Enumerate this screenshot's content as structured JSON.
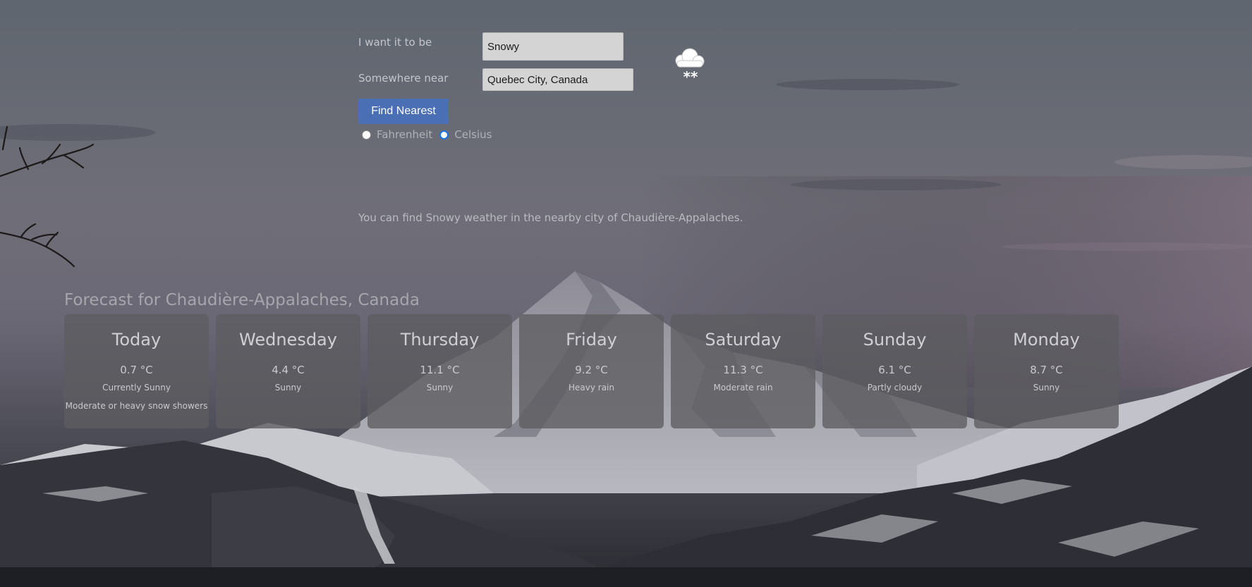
{
  "form": {
    "condition_label": "I want it to be",
    "condition_value": "Snowy",
    "location_label": "Somewhere near",
    "location_value": "Quebec City, Canada",
    "find_button": "Find Nearest",
    "units": {
      "fahrenheit_label": "Fahrenheit",
      "celsius_label": "Celsius",
      "selected": "Celsius"
    },
    "condition_icon": "snow-cloud-icon"
  },
  "result": {
    "message": "You can find Snowy weather in the nearby city of Chaudière-Appalaches."
  },
  "forecast": {
    "title": "Forecast for Chaudière-Appalaches, Canada",
    "days": [
      {
        "day": "Today",
        "temp": "0.7 °C",
        "condition": "Currently Sunny",
        "detail": "Moderate or heavy snow showers"
      },
      {
        "day": "Wednesday",
        "temp": "4.4 °C",
        "condition": "Sunny"
      },
      {
        "day": "Thursday",
        "temp": "11.1 °C",
        "condition": "Sunny"
      },
      {
        "day": "Friday",
        "temp": "9.2 °C",
        "condition": "Heavy rain"
      },
      {
        "day": "Saturday",
        "temp": "11.3 °C",
        "condition": "Moderate rain"
      },
      {
        "day": "Sunday",
        "temp": "6.1 °C",
        "condition": "Partly cloudy"
      },
      {
        "day": "Monday",
        "temp": "8.7 °C",
        "condition": "Sunny"
      }
    ]
  }
}
